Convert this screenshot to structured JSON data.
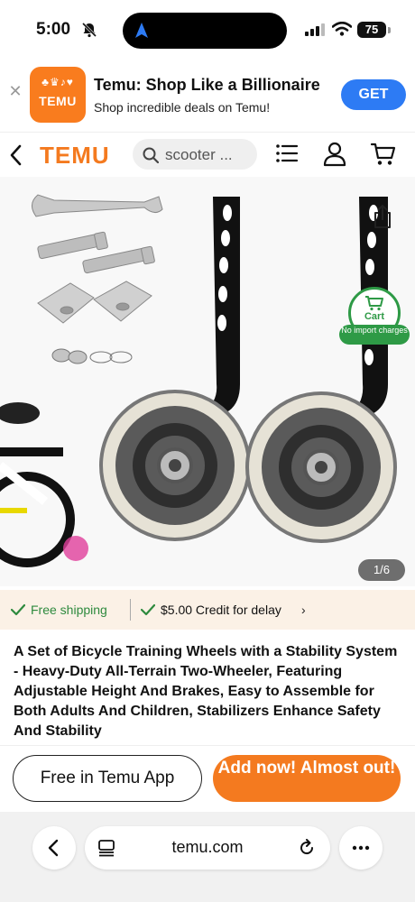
{
  "status_bar": {
    "time": "5:00",
    "battery": "75"
  },
  "app_banner": {
    "app_name": "Temu: Shop Like a Billionaire",
    "subtitle": "Shop incredible deals on Temu!",
    "icon_text": "TEMU",
    "get_label": "GET"
  },
  "header": {
    "logo": "TEMU",
    "search_text": "scooter ..."
  },
  "product": {
    "cart_badge_label": "Cart",
    "import_badge": "No import charges",
    "page_indicator": "1/6",
    "title": "A Set of Bicycle Training Wheels with a Stability System - Heavy-Duty All-Terrain Two-Wheeler, Featuring Adjustable Height And Brakes, Easy to Assemble for Both Adults And Children, Stabilizers Enhance Safety And Stability"
  },
  "shipping": {
    "free_shipping": "Free shipping",
    "credit": "$5.00 Credit for delay"
  },
  "cta": {
    "free_app": "Free in Temu App",
    "add_now": "Add now! Almost out!"
  },
  "browser": {
    "url": "temu.com"
  },
  "colors": {
    "brand": "#f47a1f",
    "green": "#2e9a46",
    "get_blue": "#2d7bf4"
  },
  "icons": [
    "bell-slash-icon",
    "location-arrow-icon",
    "signal-icon",
    "wifi-icon",
    "close-icon",
    "chevron-left-icon",
    "search-icon",
    "menu-list-icon",
    "user-icon",
    "cart-icon",
    "share-icon",
    "check-icon",
    "chevron-right-icon",
    "reader-icon",
    "reload-icon",
    "more-icon"
  ]
}
